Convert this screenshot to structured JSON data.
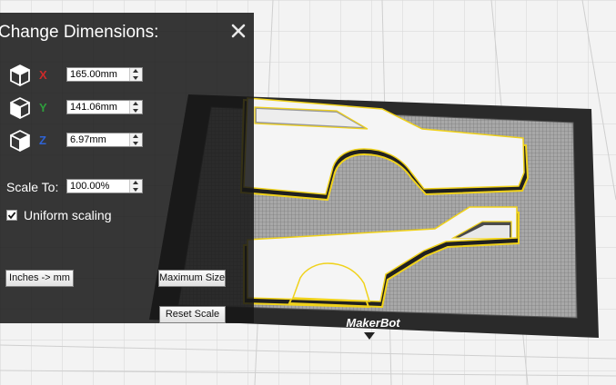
{
  "panel": {
    "title": "Change Dimensions:",
    "close_icon": "close-icon"
  },
  "dimensions": [
    {
      "axis": "X",
      "value": "165.00mm",
      "color": "#cc2a2a",
      "icon": "cube-x-icon"
    },
    {
      "axis": "Y",
      "value": "141.06mm",
      "color": "#2e9e3c",
      "icon": "cube-y-icon"
    },
    {
      "axis": "Z",
      "value": "6.97mm",
      "color": "#2f63d4",
      "icon": "cube-z-icon"
    }
  ],
  "scale": {
    "label": "Scale To:",
    "value": "100.00%"
  },
  "uniform": {
    "label": "Uniform scaling",
    "checked": true
  },
  "buttons": {
    "inches_to_mm": "Inches -> mm",
    "maximum_size": "Maximum Size",
    "reset_scale": "Reset Scale"
  },
  "build_plate": {
    "brand": "MakerBot"
  },
  "colors": {
    "panel_bg": "#161616",
    "selection_outline": "#f0d21b",
    "plate_frame": "#2b2b2b",
    "plate_grid": "#8d8d8d"
  }
}
